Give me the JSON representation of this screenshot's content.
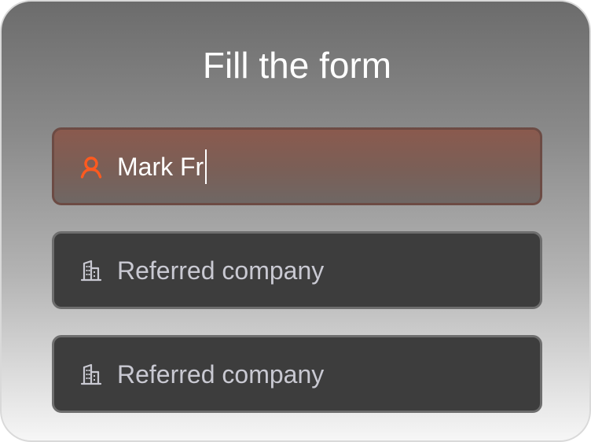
{
  "form": {
    "title": "Fill the form",
    "accent_color": "#ff5a1f",
    "fields": [
      {
        "icon": "user-icon",
        "value": "Mark Fr",
        "state": "focused"
      },
      {
        "icon": "building-icon",
        "placeholder": "Referred company"
      },
      {
        "icon": "building-icon",
        "placeholder": "Referred company"
      }
    ]
  }
}
